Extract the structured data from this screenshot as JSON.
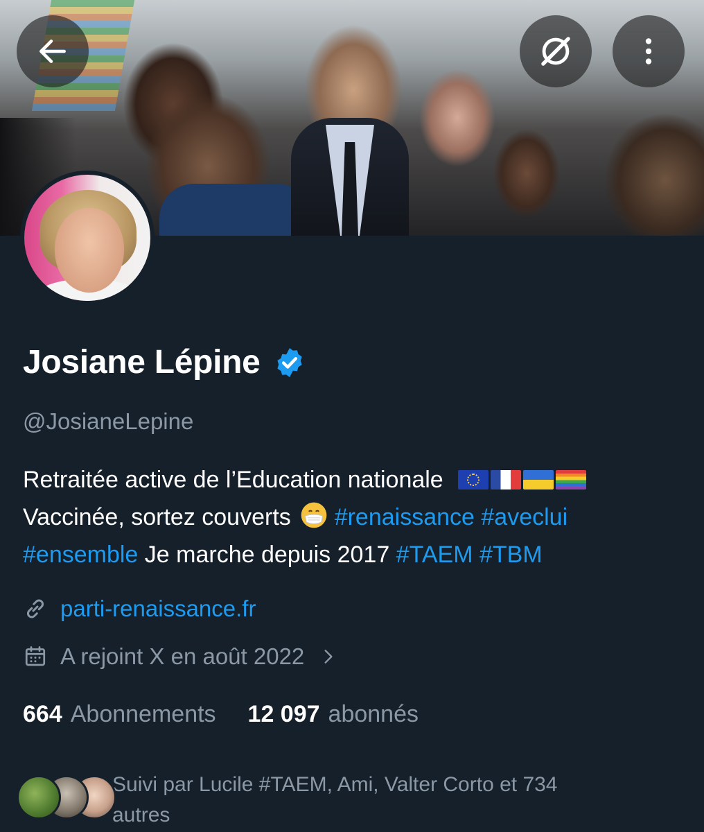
{
  "profile": {
    "name": "Josiane Lépine",
    "handle": "@JosianeLepine",
    "bio": {
      "line1_text": "Retraitée active de l’Education nationale",
      "line2_text": "Vaccinée, sortez couverts",
      "tag_renaissance": "#renaissance",
      "tag_aveclui": "#aveclui",
      "tag_ensemble": "#ensemble",
      "marche_text": "Je marche depuis 2017",
      "tag_taem": "#TAEM",
      "tag_tbm": "#TBM",
      "flags": [
        "eu-flag",
        "france-flag",
        "ukraine-flag",
        "rainbow-flag"
      ],
      "emoji": "face-with-medical-mask"
    },
    "website": "parti-renaissance.fr",
    "joined": "A rejoint X en août 2022",
    "following_count": "664",
    "following_label": "Abonnements",
    "followers_count": "12 097",
    "followers_label": "abonnés",
    "followed_by_line1": "Suivi par Lucile #TAEM, Ami, Valter Corto et 734",
    "followed_by_line2": "autres"
  },
  "icons": {
    "back": "arrow-left-icon",
    "explore": "compass-slash-icon",
    "more": "more-vertical-icon",
    "verified": "verified-badge-icon",
    "link": "link-icon",
    "calendar": "calendar-icon",
    "chevron": "chevron-right-icon"
  },
  "colors": {
    "background": "#15202b",
    "accent": "#1d9bf0",
    "secondary_text": "#8b98a5",
    "primary_text": "#ffffff"
  }
}
